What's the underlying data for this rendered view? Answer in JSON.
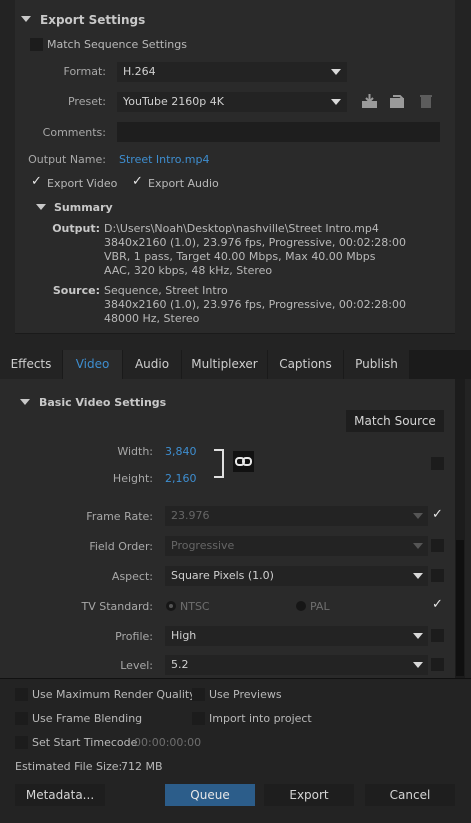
{
  "export_settings": {
    "title": "Export Settings",
    "match_sequence_label": "Match Sequence Settings",
    "format_label": "Format:",
    "format_value": "H.264",
    "preset_label": "Preset:",
    "preset_value": "YouTube 2160p 4K",
    "comments_label": "Comments:",
    "comments_value": "",
    "output_name_label": "Output Name:",
    "output_name_value": "Street Intro.mp4",
    "export_video_label": "Export Video",
    "export_audio_label": "Export Audio",
    "summary_title": "Summary",
    "output_key": "Output:",
    "output_lines": [
      "D:\\Users\\Noah\\Desktop\\nashville\\Street Intro.mp4",
      "3840x2160 (1.0), 23.976 fps, Progressive, 00:02:28:00",
      "VBR, 1 pass, Target 40.00 Mbps, Max 40.00 Mbps",
      "AAC, 320 kbps, 48 kHz, Stereo"
    ],
    "source_key": "Source:",
    "source_lines": [
      "Sequence, Street Intro",
      "3840x2160 (1.0), 23.976 fps, Progressive, 00:02:28:00",
      "48000 Hz, Stereo"
    ]
  },
  "tabs": [
    {
      "label": "Effects",
      "active": false
    },
    {
      "label": "Video",
      "active": true
    },
    {
      "label": "Audio",
      "active": false
    },
    {
      "label": "Multiplexer",
      "active": false
    },
    {
      "label": "Captions",
      "active": false
    },
    {
      "label": "Publish",
      "active": false
    }
  ],
  "video": {
    "section_title": "Basic Video Settings",
    "match_source_label": "Match Source",
    "width_label": "Width:",
    "width_value": "3,840",
    "height_label": "Height:",
    "height_value": "2,160",
    "frame_rate_label": "Frame Rate:",
    "frame_rate_value": "23.976",
    "field_order_label": "Field Order:",
    "field_order_value": "Progressive",
    "aspect_label": "Aspect:",
    "aspect_value": "Square Pixels (1.0)",
    "tv_standard_label": "TV Standard:",
    "ntsc_label": "NTSC",
    "pal_label": "PAL",
    "profile_label": "Profile:",
    "profile_value": "High",
    "level_label": "Level:",
    "level_value": "5.2"
  },
  "bottom": {
    "max_render_label": "Use Maximum Render Quality",
    "use_previews_label": "Use Previews",
    "frame_blending_label": "Use Frame Blending",
    "import_project_label": "Import into project",
    "set_start_timecode_label": "Set Start Timecode",
    "start_timecode_value": "00:00:00:00",
    "file_size_label": "Estimated File Size:",
    "file_size_value": "712 MB",
    "metadata_label": "Metadata...",
    "queue_label": "Queue",
    "export_label": "Export",
    "cancel_label": "Cancel"
  },
  "colors": {
    "accent": "#3e8ed0",
    "background": "#232323",
    "panel": "#2a2a2a",
    "primary_button": "#2c5d8a"
  }
}
